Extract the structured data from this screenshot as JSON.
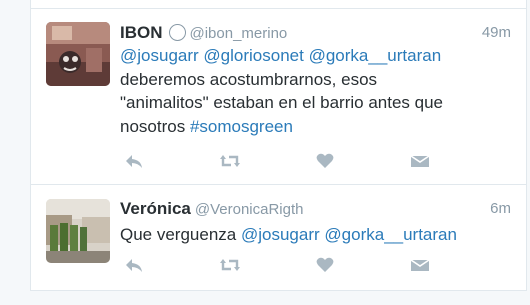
{
  "tweets": [
    {
      "name": "IBON",
      "handle": "@ibon_merino",
      "time": "49m",
      "mentions": [
        "@josugarr",
        "@gloriosonet",
        "@gorka__urtaran"
      ],
      "text_line1": "deberemos acostumbrarnos, esos",
      "text_line2": "\"animalitos\" estaban en el barrio antes que",
      "text_line3": "nosotros",
      "hashtag": "#somosgreen"
    },
    {
      "name": "Verónica",
      "handle": "@VeronicaRigth",
      "time": "6m",
      "text_start": "Que verguenza",
      "mentions": [
        "@josugarr",
        "@gorka__urtaran"
      ]
    }
  ],
  "colors": {
    "link": "#2b7bb9",
    "muted": "#8899a6",
    "icon": "#aab8c2",
    "text": "#292f33"
  },
  "icons": [
    "reply-icon",
    "retweet-icon",
    "like-icon",
    "direct-message-icon"
  ]
}
